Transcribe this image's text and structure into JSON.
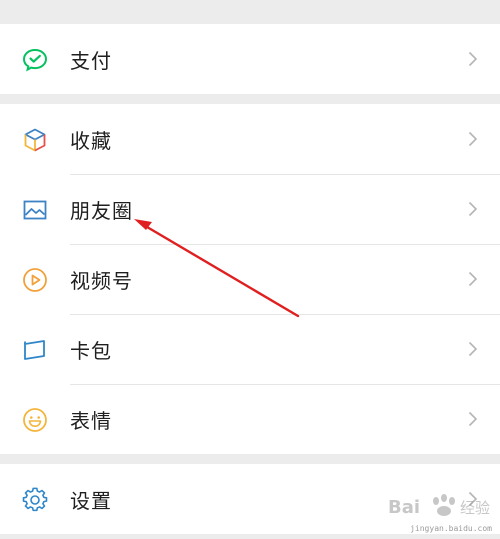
{
  "groups": [
    {
      "items": [
        {
          "label": "支付",
          "icon": "wechat-pay-icon"
        }
      ]
    },
    {
      "items": [
        {
          "label": "收藏",
          "icon": "favorites-cube-icon"
        },
        {
          "label": "朋友圈",
          "icon": "moments-image-icon"
        },
        {
          "label": "视频号",
          "icon": "channels-play-icon"
        },
        {
          "label": "卡包",
          "icon": "card-wallet-icon"
        },
        {
          "label": "表情",
          "icon": "sticker-smile-icon"
        }
      ]
    },
    {
      "items": [
        {
          "label": "设置",
          "icon": "settings-gear-icon"
        }
      ]
    }
  ],
  "colors": {
    "background": "#ececec",
    "row": "#ffffff",
    "text": "#1f1f1f",
    "chevron": "#b5b5b5",
    "annotation_arrow": "#e02020",
    "pay_green": "#07c160",
    "moments_blue": "#3d82c4",
    "channels_orange": "#f0a13a",
    "card_blue": "#2e86c9",
    "sticker_yellow": "#f3b63b",
    "settings_blue": "#2e86c9"
  },
  "watermark": {
    "brand": "Bai 经验",
    "url": "jingyan.baidu.com"
  }
}
